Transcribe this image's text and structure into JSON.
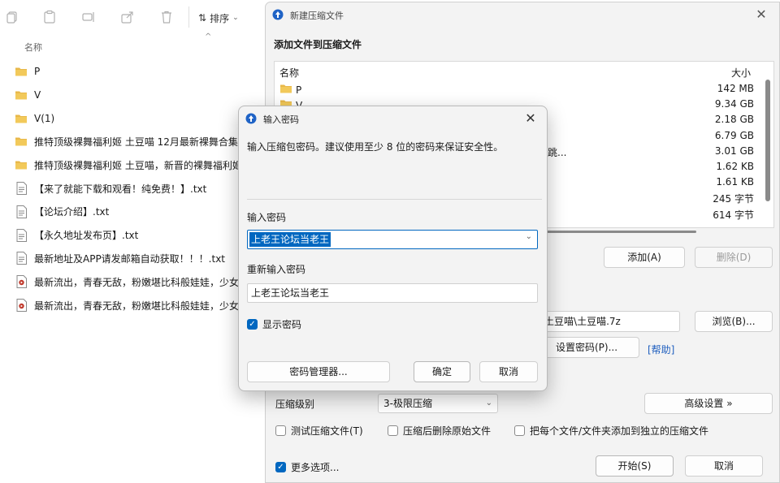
{
  "explorer": {
    "toolbar": {
      "sort_label": "排序"
    },
    "column_name": "名称",
    "files": [
      {
        "label": "P",
        "type": "folder"
      },
      {
        "label": "V",
        "type": "folder"
      },
      {
        "label": "V(1)",
        "type": "folder"
      },
      {
        "label": "推特顶级裸舞福利姬 土豆喵 12月最新裸舞合集",
        "type": "folder"
      },
      {
        "label": "推特顶级裸舞福利姬 土豆喵，新晋的裸舞福利姬",
        "type": "folder"
      },
      {
        "label": "【来了就能下载和观看！纯免费！】.txt",
        "type": "txt"
      },
      {
        "label": "【论坛介绍】.txt",
        "type": "txt"
      },
      {
        "label": "【永久地址发布页】.txt",
        "type": "txt"
      },
      {
        "label": "最新地址及APP请发邮箱自动获取！！！.txt",
        "type": "txt"
      },
      {
        "label": "最新流出，青春无敌，粉嫩堪比科般娃娃，少女",
        "type": "video"
      },
      {
        "label": "最新流出，青春无敌，粉嫩堪比科般娃娃，少女",
        "type": "video"
      }
    ]
  },
  "zipwin": {
    "title": "新建压缩文件",
    "heading": "添加文件到压缩文件",
    "list_header": {
      "name": "名称",
      "size": "大小"
    },
    "rows": [
      {
        "name": "P",
        "size": "142 MB",
        "folder": true
      },
      {
        "name": "V",
        "size": "9.34 GB",
        "folder": true
      },
      {
        "name": "",
        "size": "2.18 GB",
        "folder": false
      },
      {
        "name": "",
        "size": "6.79 GB",
        "folder": false
      },
      {
        "name": "跳...",
        "size": "3.01 GB",
        "folder": false
      },
      {
        "name": "",
        "size": "1.62 KB",
        "folder": false
      },
      {
        "name": "",
        "size": "1.61 KB",
        "folder": false
      },
      {
        "name": "",
        "size": "245 字节",
        "folder": false
      },
      {
        "name": "",
        "size": "614 字节",
        "folder": false
      }
    ],
    "add_button": "添加(A)",
    "delete_button": "删除(D)",
    "path_fragment": "\\土豆喵\\土豆喵.7z",
    "browse_button": "浏览(B)...",
    "set_password_button": "设置密码(P)...",
    "help_link": "[帮助]",
    "level_label": "压缩级别",
    "level_value": "3-极限压缩",
    "advanced_button": "高级设置 »",
    "checkbox_test": "测试压缩文件(T)",
    "checkbox_delete": "压缩后删除原始文件",
    "checkbox_separate": "把每个文件/文件夹添加到独立的压缩文件",
    "checkbox_more": "更多选项...",
    "start_button": "开始(S)",
    "cancel_button": "取消"
  },
  "pwdialog": {
    "title": "输入密码",
    "description": "输入压缩包密码。建议使用至少 8 位的密码来保证安全性。",
    "label_password": "输入密码",
    "password_value": "上老王论坛当老王",
    "label_confirm": "重新输入密码",
    "confirm_value": "上老王论坛当老王",
    "show_password": "显示密码",
    "manager_button": "密码管理器...",
    "ok_button": "确定",
    "cancel_button": "取消"
  },
  "colors": {
    "accent": "#0067c0",
    "folder": "#e8b84a",
    "link": "#1f5fbf"
  }
}
